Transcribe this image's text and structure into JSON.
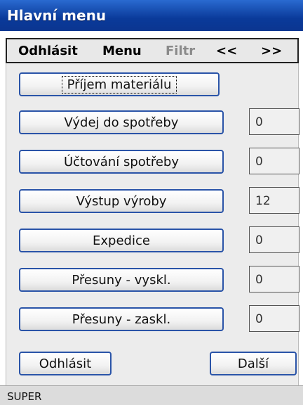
{
  "window": {
    "title": "Hlavní menu"
  },
  "menu": {
    "logout": "Odhlásit",
    "menu": "Menu",
    "filter": "Filtr",
    "prev": "<<",
    "next": ">>"
  },
  "actions": [
    {
      "label": "Příjem materiálu",
      "value": null
    },
    {
      "label": "Výdej do spotřeby",
      "value": "0"
    },
    {
      "label": "Účtování spotřeby",
      "value": "0"
    },
    {
      "label": "Výstup výroby",
      "value": "12"
    },
    {
      "label": "Expedice",
      "value": "0"
    },
    {
      "label": "Přesuny - vyskl.",
      "value": "0"
    },
    {
      "label": "Přesuny - zaskl.",
      "value": "0"
    }
  ],
  "footer": {
    "logout_label": "Odhlásit",
    "next_label": "Další"
  },
  "status": {
    "user": "SUPER"
  }
}
